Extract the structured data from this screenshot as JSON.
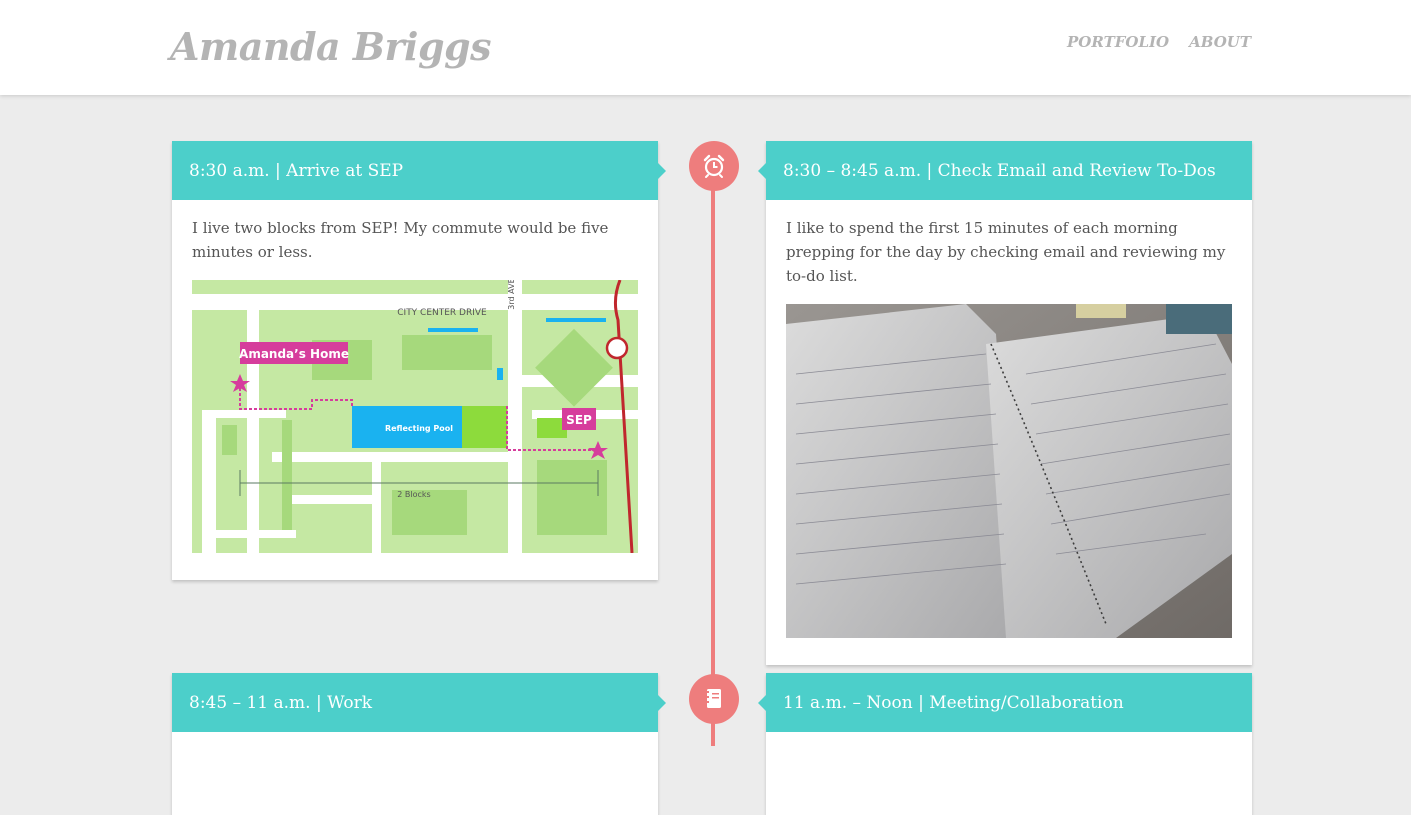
{
  "site": {
    "logo": "Amanda Briggs",
    "nav": [
      "PORTFOLIO",
      "ABOUT"
    ]
  },
  "timeline": {
    "icons": [
      "alarm-clock-icon",
      "notebook-icon"
    ],
    "color": "#ee7d7d"
  },
  "cards": [
    {
      "title": "8:30 a.m. | Arrive at SEP",
      "text": "I live two blocks from SEP! My commute would be five minutes or less.",
      "map": {
        "street": "CITY CENTER DRIVE",
        "avenue": "3rd AVE",
        "home_label": "Amanda’s Home",
        "destination_label": "SEP",
        "pool_label": "Reflecting Pool",
        "distance_label": "2 Blocks"
      }
    },
    {
      "title": "8:30 – 8:45 a.m. | Check Email and Review To-Dos",
      "text": "I like to spend the first 15 minutes of each morning prepping for the day by checking email and reviewing my to-do list."
    },
    {
      "title": "8:45 – 11 a.m. | Work"
    },
    {
      "title": "11 a.m. – Noon | Meeting/Collaboration"
    }
  ],
  "colors": {
    "accent": "#4ccfca",
    "timeline": "#ee7d7d",
    "background": "#ececec",
    "map_pink": "#d63d9c",
    "map_blue": "#1ab2f0",
    "map_green": "#c2e8a0"
  }
}
